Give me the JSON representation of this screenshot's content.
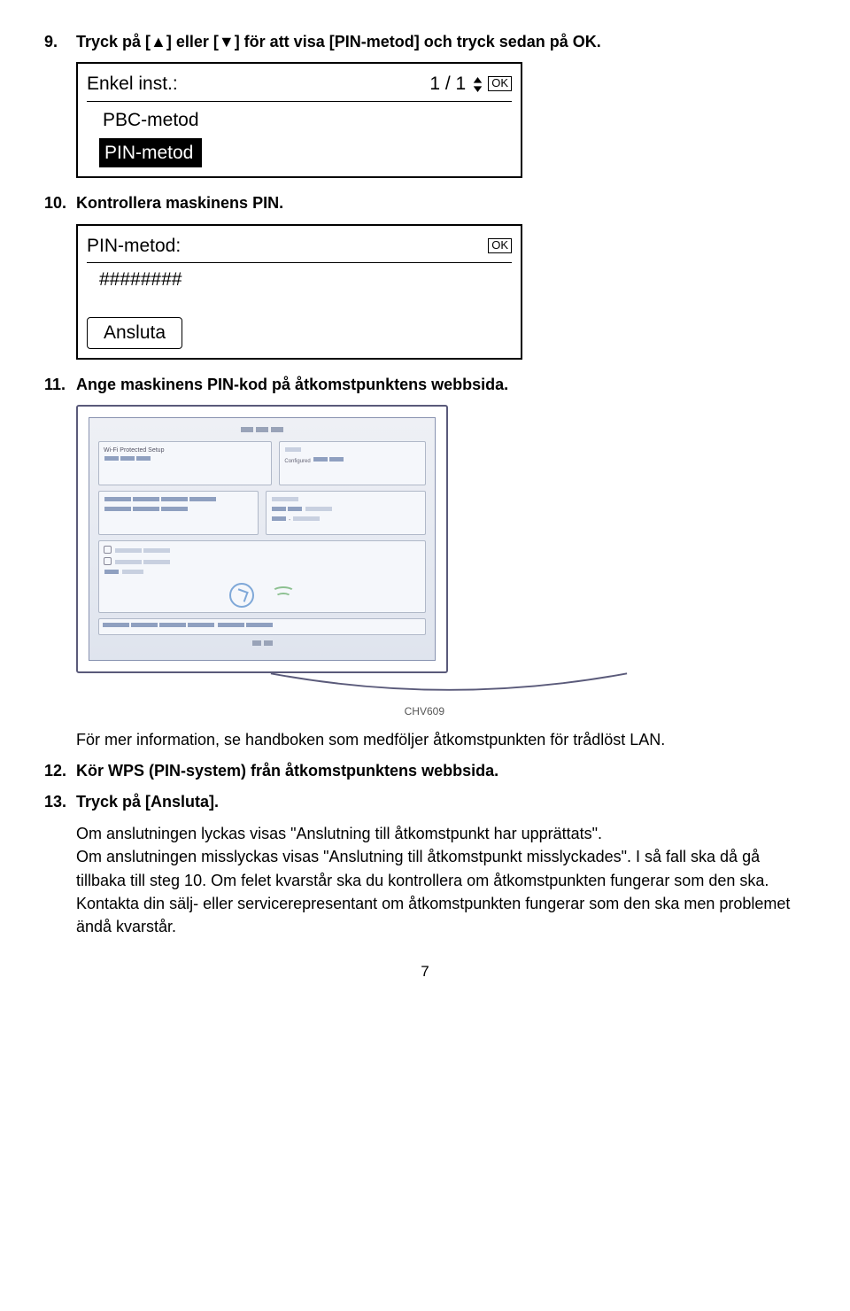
{
  "step9": {
    "num": "9.",
    "text": "Tryck på [▲] eller [▼] för att visa [PIN-metod] och tryck sedan på OK."
  },
  "lcd1": {
    "title": "Enkel inst.:",
    "pager": "1 / 1",
    "ok": "OK",
    "opt1": "PBC-metod",
    "opt2": "PIN-metod"
  },
  "step10": {
    "num": "10.",
    "text": "Kontrollera maskinens PIN."
  },
  "lcd2": {
    "title": "PIN-metod:",
    "ok": "OK",
    "pin": "########",
    "btn": "Ansluta"
  },
  "step11": {
    "num": "11.",
    "text": "Ange maskinens PIN-kod på åtkomstpunktens webbsida."
  },
  "caption": "CHV609",
  "para11": "För mer information, se handboken som medföljer åtkomstpunkten för trådlöst LAN.",
  "step12": {
    "num": "12.",
    "text": "Kör WPS (PIN-system) från åtkomstpunktens webbsida."
  },
  "step13": {
    "num": "13.",
    "text": "Tryck på [Ansluta]."
  },
  "para13": "Om anslutningen lyckas visas \"Anslutning till åtkomstpunkt har upprättats\".\nOm anslutningen misslyckas visas \"Anslutning till åtkomstpunkt misslyckades\". I så fall ska då gå tillbaka till steg 10. Om felet kvarstår ska du kontrollera om åtkomstpunkten fungerar som den ska. Kontakta din sälj- eller servicerepresentant om åtkomstpunkten fungerar som den ska men problemet ändå kvarstår.",
  "page": "7"
}
